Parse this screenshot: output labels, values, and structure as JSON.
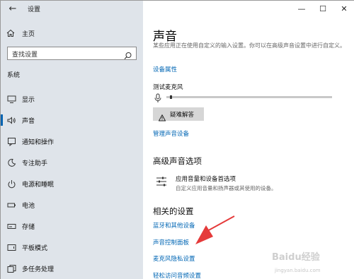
{
  "app": {
    "title": "设置"
  },
  "sidebar": {
    "home_label": "主页",
    "search_placeholder": "查找设置",
    "section_label": "系统",
    "items": [
      {
        "label": "显示",
        "icon": "display-icon"
      },
      {
        "label": "声音",
        "icon": "speaker-icon",
        "active": true
      },
      {
        "label": "通知和操作",
        "icon": "notification-icon"
      },
      {
        "label": "专注助手",
        "icon": "moon-icon"
      },
      {
        "label": "电源和睡眠",
        "icon": "power-icon"
      },
      {
        "label": "电池",
        "icon": "battery-icon"
      },
      {
        "label": "存储",
        "icon": "storage-icon"
      },
      {
        "label": "平板模式",
        "icon": "tablet-icon"
      },
      {
        "label": "多任务处理",
        "icon": "multitask-icon"
      }
    ]
  },
  "window_controls": {
    "minimize": "—",
    "maximize": "☐",
    "close": "✕"
  },
  "main": {
    "title": "声音",
    "description": "某些应用正在使用自定义的输入设置。你可以在高级声音设置中进行自定义。",
    "device_properties_link": "设备属性",
    "test_mic_label": "测试麦克风",
    "mic_level": 0.02,
    "troubleshoot_label": "疑难解答",
    "manage_devices_link": "管理声音设备",
    "advanced_heading": "高级声音选项",
    "app_volume_title": "应用音量和设备首选项",
    "app_volume_desc": "自定义应用音量和扬声器或其使用的设备。",
    "related_heading": "相关的设置",
    "related_links": [
      "蓝牙和其他设备",
      "声音控制面板",
      "麦克风隐私设置",
      "轻松访问音频设置"
    ]
  },
  "watermark": {
    "main": "Baidu经验",
    "sub": "jingyan.baidu.com"
  },
  "colors": {
    "accent": "#0063b1",
    "link": "#0066b4",
    "arrow": "#e53a3a",
    "sidebar_bg": "#dfe4ea"
  }
}
